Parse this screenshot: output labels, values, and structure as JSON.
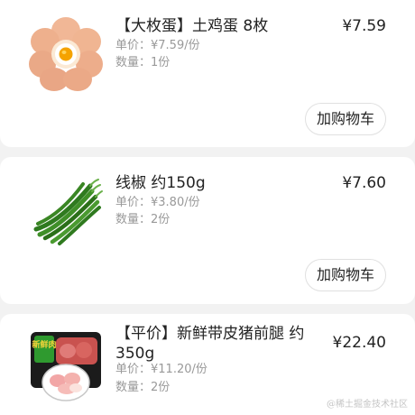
{
  "items": [
    {
      "name": "【大枚蛋】土鸡蛋 8枚",
      "price": "¥7.59",
      "unit_price": "单价：¥7.59/份",
      "quantity": "数量：1份",
      "button": "加购物车",
      "thumb_icon": "eggs-image"
    },
    {
      "name": "线椒 约150g",
      "price": "¥7.60",
      "unit_price": "单价：¥3.80/份",
      "quantity": "数量：2份",
      "button": "加购物车",
      "thumb_icon": "green-pepper-image"
    },
    {
      "name": "【平价】新鲜带皮猪前腿 约350g",
      "price": "¥22.40",
      "unit_price": "单价：¥11.20/份",
      "quantity": "数量：2份",
      "button": "加购物车",
      "thumb_icon": "pork-image",
      "package_label": "新鲜肉"
    }
  ],
  "watermark": "@稀土掘金技术社区",
  "colors": {
    "background": "#f2f2f2",
    "card": "#ffffff",
    "text": "#222222",
    "muted": "#999999",
    "button_border": "#e0e0e0"
  }
}
